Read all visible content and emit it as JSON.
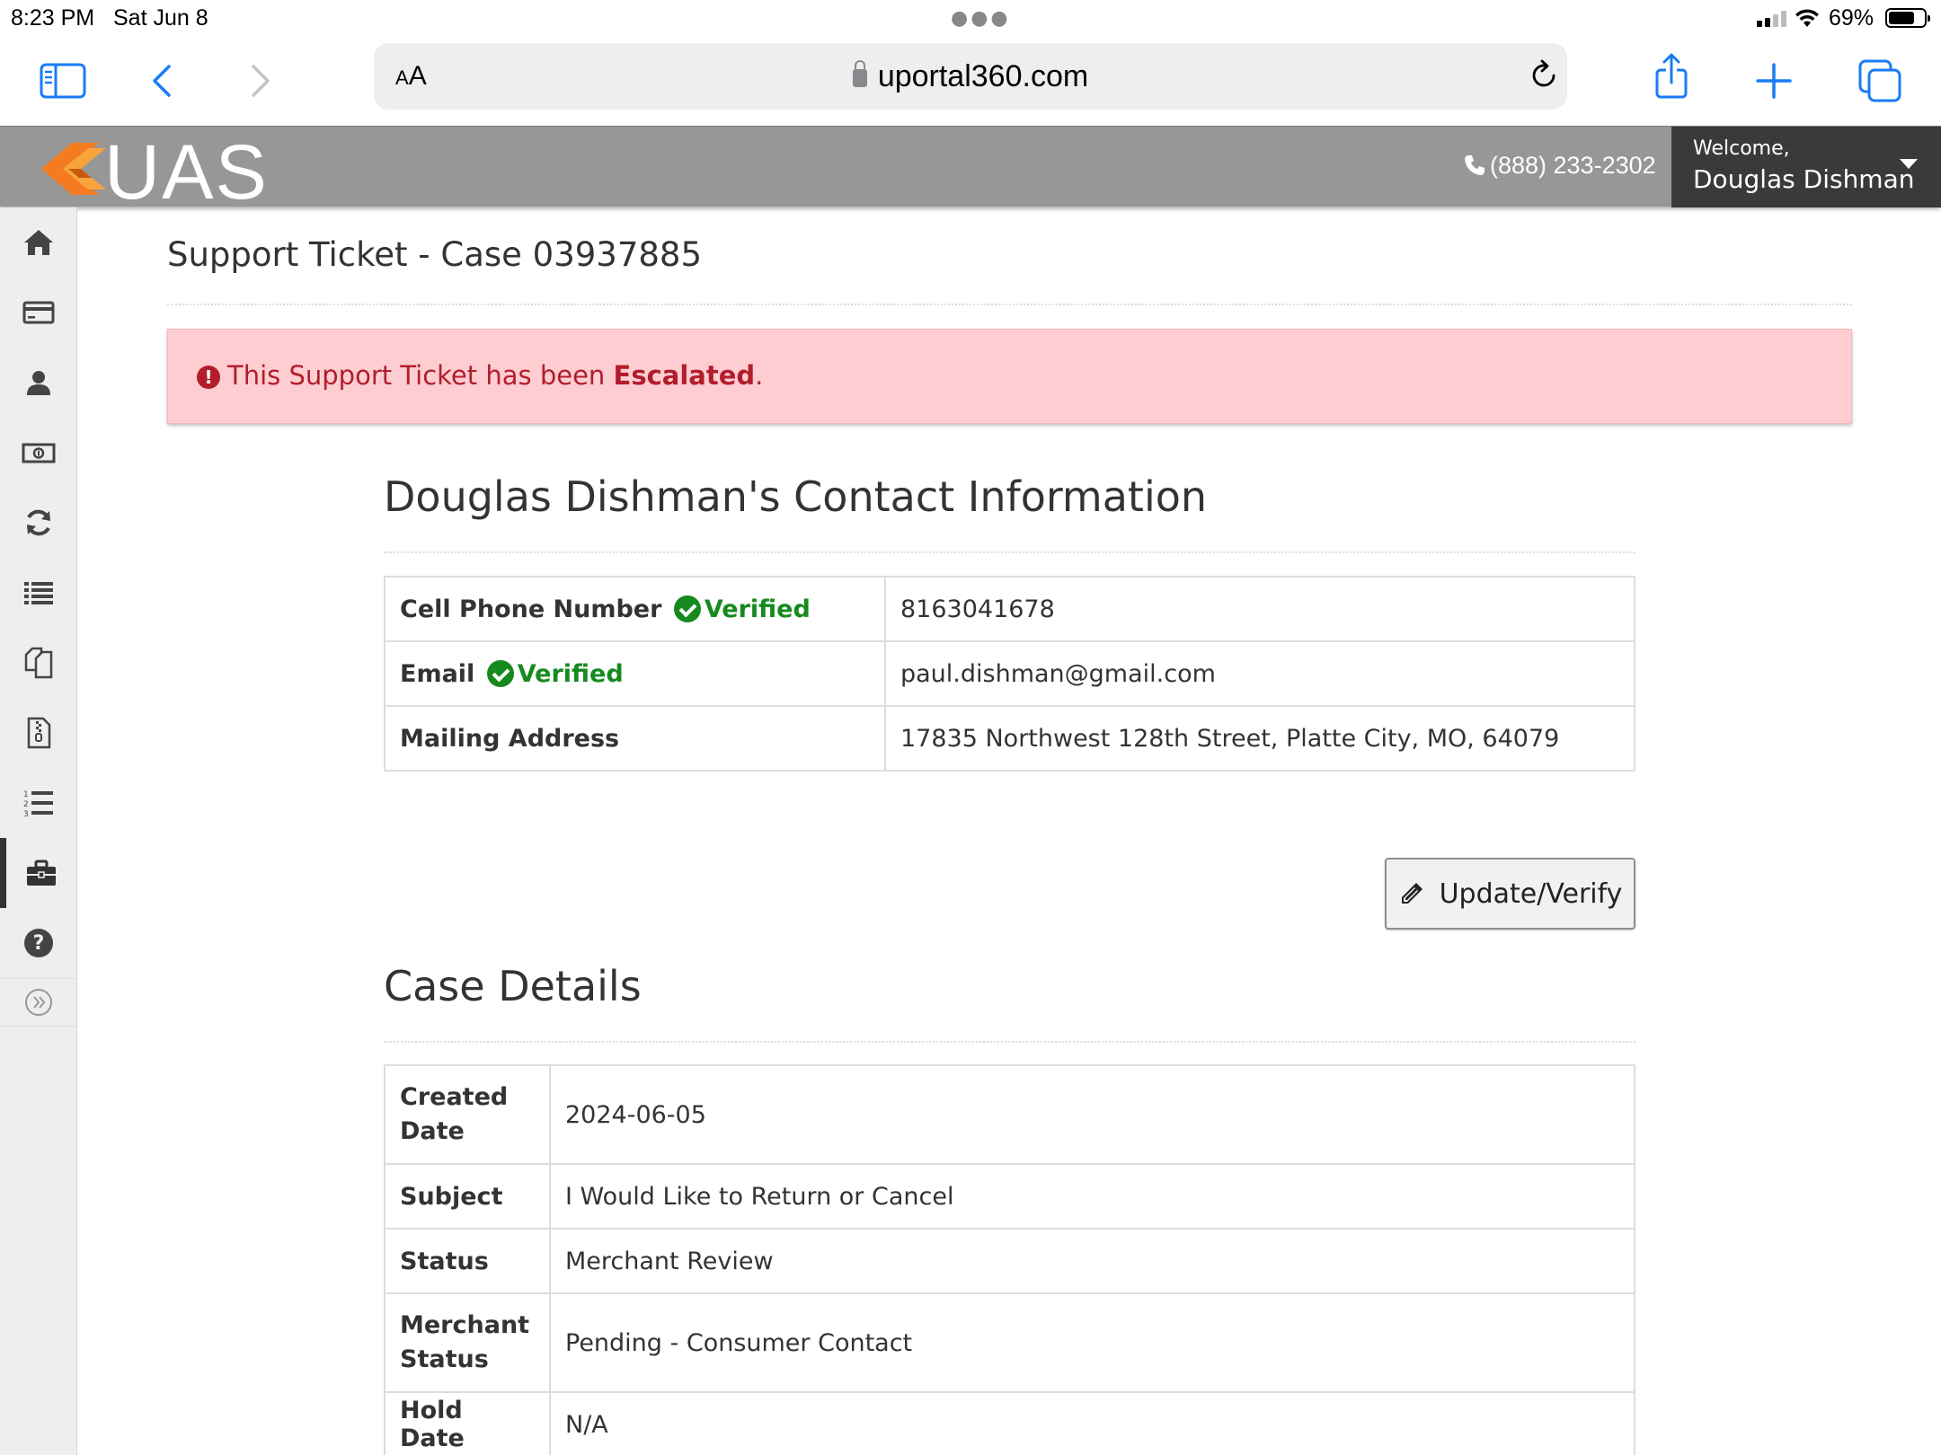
{
  "status_bar": {
    "time": "8:23 PM",
    "date": "Sat Jun 8",
    "battery": "69%"
  },
  "browser": {
    "aa": "AA",
    "url": "uportal360.com"
  },
  "header": {
    "logo": "UAS",
    "phone": "(888) 233-2302",
    "welcome": "Welcome,",
    "username": "Douglas Dishman"
  },
  "sidebar": {
    "items": [
      {
        "name": "home-icon"
      },
      {
        "name": "credit-card-icon"
      },
      {
        "name": "user-icon"
      },
      {
        "name": "money-icon"
      },
      {
        "name": "refresh-icon"
      },
      {
        "name": "list-icon"
      },
      {
        "name": "documents-icon"
      },
      {
        "name": "file-zip-icon"
      },
      {
        "name": "ordered-list-icon"
      },
      {
        "name": "briefcase-icon",
        "active": true
      },
      {
        "name": "help-icon"
      },
      {
        "name": "expand-icon"
      }
    ]
  },
  "page": {
    "title": "Support Ticket - Case 03937885"
  },
  "alert": {
    "text_before": "This Support Ticket has been ",
    "emphasis": "Escalated",
    "text_after": ".",
    "color": "#b31d2b"
  },
  "contact": {
    "title": "Douglas Dishman's Contact Information",
    "verified_label": "Verified",
    "rows": [
      {
        "label": "Cell Phone Number",
        "verified": true,
        "value": "8163041678"
      },
      {
        "label": "Email",
        "verified": true,
        "value": "paul.dishman@gmail.com"
      },
      {
        "label": "Mailing Address",
        "verified": false,
        "value": "17835 Northwest 128th Street, Platte City, MO, 64079"
      }
    ],
    "update_button": "Update/Verify"
  },
  "case_details": {
    "title": "Case Details",
    "rows": [
      {
        "label": "Created Date",
        "value": "2024-06-05"
      },
      {
        "label": "Subject",
        "value": "I Would Like to Return or Cancel"
      },
      {
        "label": "Status",
        "value": "Merchant Review"
      },
      {
        "label": "Merchant Status",
        "value": "Pending - Consumer Contact"
      },
      {
        "label": "Hold Date",
        "value": "N/A"
      }
    ]
  },
  "colors": {
    "verified": "#178a1f",
    "header_gray": "#979797",
    "user_box": "#3a3a3a",
    "logo_orange": "#f47b20"
  }
}
